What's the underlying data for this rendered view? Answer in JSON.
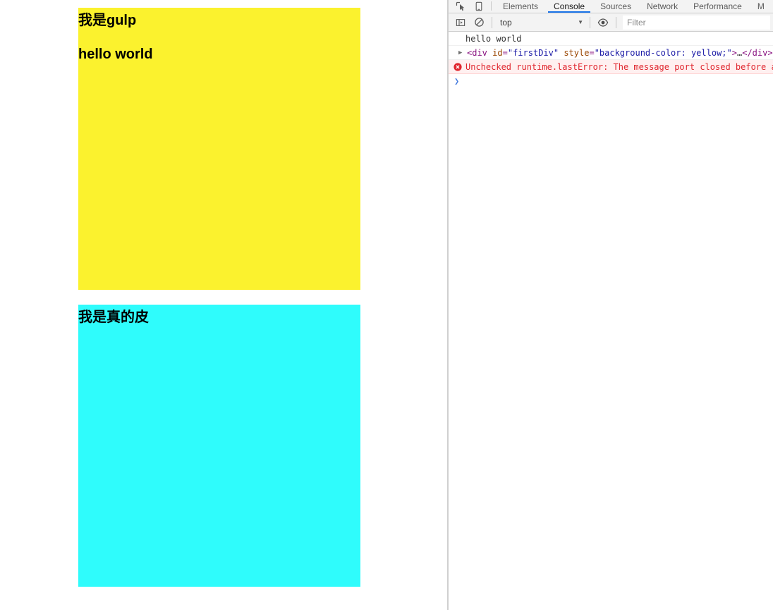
{
  "page": {
    "blocks": [
      {
        "id": "firstDiv",
        "background_color": "#fbf22e",
        "lines": [
          "我是gulp",
          "hello world"
        ]
      },
      {
        "id": "secondDiv",
        "background_color": "#2ffcfc",
        "lines": [
          "我是真的皮"
        ]
      }
    ]
  },
  "devtools": {
    "accent_color": "#1a73e8",
    "toolbar_icons": {
      "inspect": "inspect-element-icon",
      "device": "device-toolbar-icon"
    },
    "tabs": [
      {
        "label": "Elements",
        "active": false
      },
      {
        "label": "Console",
        "active": true
      },
      {
        "label": "Sources",
        "active": false
      },
      {
        "label": "Network",
        "active": false
      },
      {
        "label": "Performance",
        "active": false
      },
      {
        "label": "M",
        "active": false
      }
    ],
    "console_toolbar": {
      "execute_icon": "console-sidebar-icon",
      "clear_icon": "clear-console-icon",
      "context": "top",
      "context_caret": "▼",
      "eye_icon": "live-expression-icon",
      "filter_placeholder": "Filter",
      "filter_value": ""
    },
    "messages": [
      {
        "type": "log",
        "text": "hello world"
      },
      {
        "type": "dom",
        "arrow": "▶",
        "parts": [
          {
            "token": "punct",
            "text": "<"
          },
          {
            "token": "tag",
            "text": "div"
          },
          {
            "token": "plain",
            "text": " "
          },
          {
            "token": "attr",
            "text": "id"
          },
          {
            "token": "punct",
            "text": "="
          },
          {
            "token": "val",
            "text": "\"firstDiv\""
          },
          {
            "token": "plain",
            "text": " "
          },
          {
            "token": "attr",
            "text": "style"
          },
          {
            "token": "punct",
            "text": "="
          },
          {
            "token": "val",
            "text": "\"background-color: yellow;\""
          },
          {
            "token": "punct",
            "text": ">"
          },
          {
            "token": "ellip",
            "text": "…"
          },
          {
            "token": "punct",
            "text": "</div>"
          }
        ]
      },
      {
        "type": "error",
        "icon": "error-circle-icon",
        "text": "Unchecked runtime.lastError: The message port closed before a"
      }
    ],
    "prompt": {
      "chevron": "❯",
      "value": "",
      "placeholder": ""
    }
  }
}
